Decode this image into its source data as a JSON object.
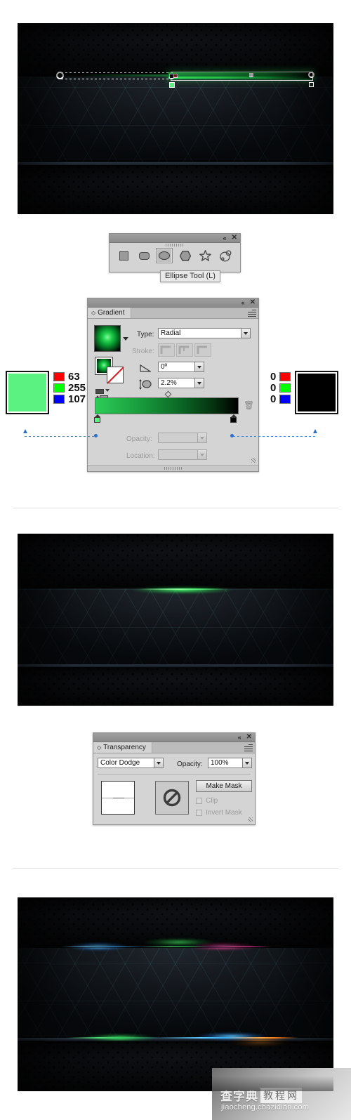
{
  "document": {
    "title": "Illustrator tutorial — glowing gradient line steps"
  },
  "artwork_top": {
    "name": "hex-background-with-gradient-line-selected",
    "description": "Dark hexagon-pattern banner with a bright green horizontal gradient stroke selected, showing gradient annotator handles"
  },
  "tools_panel": {
    "collapse_label": "«",
    "close_label": "✕",
    "tools": [
      {
        "name": "rectangle-tool",
        "glyph": "rect",
        "selected": false
      },
      {
        "name": "rounded-rectangle-tool",
        "glyph": "rounded",
        "selected": false
      },
      {
        "name": "ellipse-tool",
        "glyph": "ellipse",
        "selected": true
      },
      {
        "name": "polygon-tool",
        "glyph": "hexagon",
        "selected": false
      },
      {
        "name": "star-tool",
        "glyph": "star",
        "selected": false
      },
      {
        "name": "flare-tool",
        "glyph": "flare",
        "selected": false
      }
    ],
    "tooltip": "Ellipse Tool (L)"
  },
  "gradient_panel": {
    "collapse_label": "«",
    "close_label": "✕",
    "tab_label": "Gradient",
    "type_label": "Type:",
    "type_value": "Radial",
    "stroke_label": "Stroke:",
    "angle_label": "angle-icon",
    "angle_value": "0º",
    "aspect_label": "aspect-ratio-icon",
    "aspect_value": "2.2%",
    "opacity_label": "Opacity:",
    "opacity_value": "",
    "location_label": "Location:",
    "location_value": "",
    "gradient_css": "linear-gradient(to right,#2ecc58 0%, #1aa13f 28%, #0b6b27 58%, #04340f 82%, #000 100%)"
  },
  "left_color": {
    "name": "gradient-start-color",
    "swatch_hex": "#5cf282",
    "channels": [
      {
        "label": "R",
        "swatch_hex": "#ff0000",
        "value": "63"
      },
      {
        "label": "G",
        "swatch_hex": "#00ff00",
        "value": "255"
      },
      {
        "label": "B",
        "swatch_hex": "#0000ff",
        "value": "107"
      }
    ]
  },
  "right_color": {
    "name": "gradient-end-color",
    "swatch_hex": "#000000",
    "channels": [
      {
        "label": "R",
        "swatch_hex": "#ff0000",
        "value": "0"
      },
      {
        "label": "G",
        "swatch_hex": "#00ff00",
        "value": "0"
      },
      {
        "label": "B",
        "swatch_hex": "#0000ff",
        "value": "0"
      }
    ]
  },
  "artwork_middle": {
    "name": "hex-background-with-green-glow",
    "description": "Dark hexagon banner with a thin green glowing line blended into the seam"
  },
  "transparency_panel": {
    "collapse_label": "«",
    "close_label": "✕",
    "tab_label": "Transparency",
    "blend_mode": "Color Dodge",
    "opacity_label": "Opacity:",
    "opacity_value": "100%",
    "make_mask_label": "Make Mask",
    "clip_label": "Clip",
    "invert_mask_label": "Invert Mask",
    "clip_checked": false,
    "invert_checked": false
  },
  "artwork_bottom": {
    "name": "hex-background-with-multicolor-glow",
    "description": "Dark hexagon banner with blue, green, magenta and orange glowing streaks along the seam"
  },
  "watermark": {
    "cn_primary": "查字典",
    "cn_secondary": "教程网",
    "url": "jiaocheng.chazidian.com"
  }
}
